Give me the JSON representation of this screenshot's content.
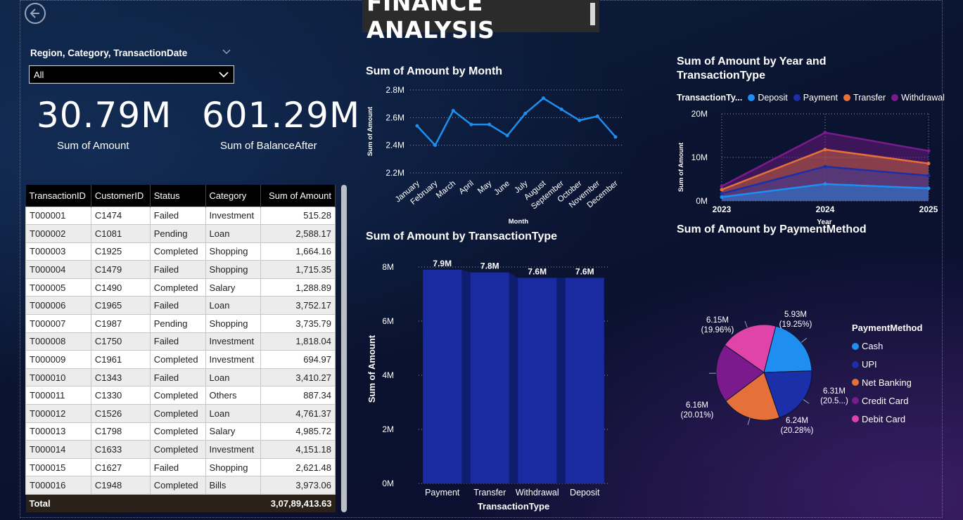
{
  "title": "FINANCE ANALYSIS",
  "slicer": {
    "label": "Region, Category, TransactionDate",
    "value": "All"
  },
  "kpis": [
    {
      "value": "30.79M",
      "label": "Sum of Amount"
    },
    {
      "value": "601.29M",
      "label": "Sum of BalanceAfter"
    }
  ],
  "table": {
    "columns": [
      "TransactionID",
      "CustomerID",
      "Status",
      "Category",
      "Sum of Amount"
    ],
    "rows": [
      [
        "T000001",
        "C1474",
        "Failed",
        "Investment",
        "515.28"
      ],
      [
        "T000002",
        "C1081",
        "Pending",
        "Loan",
        "2,588.17"
      ],
      [
        "T000003",
        "C1925",
        "Completed",
        "Shopping",
        "1,664.16"
      ],
      [
        "T000004",
        "C1479",
        "Failed",
        "Shopping",
        "1,715.35"
      ],
      [
        "T000005",
        "C1490",
        "Completed",
        "Salary",
        "1,288.89"
      ],
      [
        "T000006",
        "C1965",
        "Failed",
        "Loan",
        "3,752.17"
      ],
      [
        "T000007",
        "C1987",
        "Pending",
        "Shopping",
        "3,735.79"
      ],
      [
        "T000008",
        "C1750",
        "Failed",
        "Investment",
        "1,818.04"
      ],
      [
        "T000009",
        "C1961",
        "Completed",
        "Investment",
        "694.97"
      ],
      [
        "T000010",
        "C1343",
        "Failed",
        "Loan",
        "3,410.27"
      ],
      [
        "T000011",
        "C1330",
        "Completed",
        "Others",
        "887.34"
      ],
      [
        "T000012",
        "C1526",
        "Completed",
        "Loan",
        "4,761.37"
      ],
      [
        "T000013",
        "C1798",
        "Completed",
        "Salary",
        "4,985.72"
      ],
      [
        "T000014",
        "C1633",
        "Completed",
        "Investment",
        "4,151.18"
      ],
      [
        "T000015",
        "C1627",
        "Failed",
        "Shopping",
        "2,621.48"
      ],
      [
        "T000016",
        "C1948",
        "Completed",
        "Bills",
        "3,973.06"
      ]
    ],
    "total_label": "Total",
    "total_value": "3,07,89,413.63"
  },
  "chart_data": [
    {
      "id": "by_month",
      "type": "line",
      "title": "Sum of Amount by Month",
      "xlabel": "Month",
      "ylabel": "Sum of Amount",
      "categories": [
        "January",
        "February",
        "March",
        "April",
        "May",
        "June",
        "July",
        "August",
        "September",
        "October",
        "November",
        "December"
      ],
      "values": [
        2.54,
        2.4,
        2.65,
        2.55,
        2.55,
        2.47,
        2.63,
        2.74,
        2.66,
        2.58,
        2.61,
        2.46
      ],
      "ylim": [
        2.2,
        2.8
      ],
      "yticks": [
        "2.2M",
        "2.4M",
        "2.6M",
        "2.8M"
      ],
      "unit": "M",
      "color": "#1f8ef1"
    },
    {
      "id": "by_year_type",
      "type": "area",
      "title": "Sum of Amount by Year and TransactionType",
      "legend_title": "TransactionTy...",
      "xlabel": "Year",
      "ylabel": "Sum of Amount",
      "categories": [
        "2023",
        "2024",
        "2025"
      ],
      "ylim": [
        0,
        20
      ],
      "yticks": [
        "0M",
        "10M",
        "20M"
      ],
      "series": [
        {
          "name": "Deposit",
          "values": [
            0.9,
            3.9,
            2.9
          ],
          "color": "#1f8ef1"
        },
        {
          "name": "Payment",
          "values": [
            1.7,
            7.9,
            5.8
          ],
          "color": "#1a2fa8"
        },
        {
          "name": "Transfer",
          "values": [
            2.6,
            11.8,
            8.6
          ],
          "color": "#e6703a"
        },
        {
          "name": "Withdrawal",
          "values": [
            3.4,
            15.7,
            11.5
          ],
          "color": "#7a1a8c"
        }
      ]
    },
    {
      "id": "by_transaction_type",
      "type": "bar",
      "title": "Sum of Amount by TransactionType",
      "xlabel": "TransactionType",
      "ylabel": "Sum of Amount",
      "categories": [
        "Payment",
        "Transfer",
        "Withdrawal",
        "Deposit"
      ],
      "values": [
        7.9,
        7.8,
        7.6,
        7.6
      ],
      "data_labels": [
        "7.9M",
        "7.8M",
        "7.6M",
        "7.6M"
      ],
      "ylim": [
        0,
        8
      ],
      "yticks": [
        "0M",
        "2M",
        "4M",
        "6M",
        "8M"
      ],
      "color": "#1a2aa0"
    },
    {
      "id": "by_payment_method",
      "type": "pie",
      "title": "Sum of Amount by PaymentMethod",
      "legend_title": "PaymentMethod",
      "slices": [
        {
          "name": "Cash",
          "value": 6.31,
          "label1": "6.31M",
          "label2": "(20.5...)",
          "color": "#1f8ef1"
        },
        {
          "name": "UPI",
          "value": 6.24,
          "label1": "6.24M",
          "label2": "(20.28%)",
          "color": "#1a2fa8"
        },
        {
          "name": "Net Banking",
          "value": 6.16,
          "label1": "6.16M",
          "label2": "(20.01%)",
          "color": "#e6703a"
        },
        {
          "name": "Credit Card",
          "value": 6.15,
          "label1": "6.15M",
          "label2": "(19.96%)",
          "color": "#7a1a8c"
        },
        {
          "name": "Debit Card",
          "value": 5.93,
          "label1": "5.93M",
          "label2": "(19.25%)",
          "color": "#e044a8"
        }
      ]
    }
  ]
}
